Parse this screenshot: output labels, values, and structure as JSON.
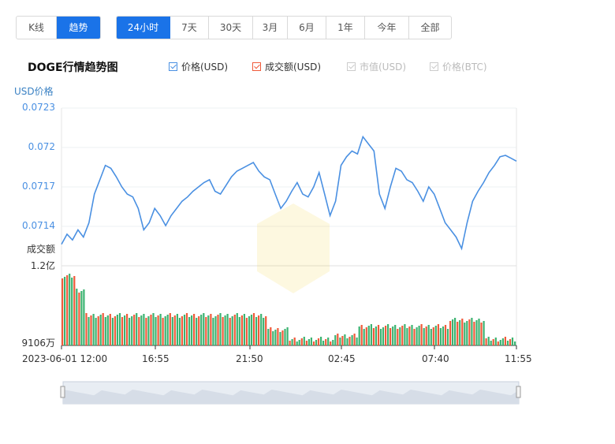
{
  "tabs_view": [
    {
      "label": "K线",
      "active": false
    },
    {
      "label": "趋势",
      "active": true
    }
  ],
  "tabs_range": [
    {
      "label": "24小时",
      "active": true
    },
    {
      "label": "7天",
      "active": false
    },
    {
      "label": "30天",
      "active": false
    },
    {
      "label": "3月",
      "active": false
    },
    {
      "label": "6月",
      "active": false
    },
    {
      "label": "1年",
      "active": false
    },
    {
      "label": "今年",
      "active": false
    },
    {
      "label": "全部",
      "active": false
    }
  ],
  "chart_title": "DOGE行情趋势图",
  "legend": [
    {
      "label": "价格(USD)",
      "checked": true,
      "color": "#4a90e2",
      "enabled": true
    },
    {
      "label": "成交额(USD)",
      "checked": true,
      "color": "#f05a3a",
      "enabled": true
    },
    {
      "label": "市值(USD)",
      "checked": false,
      "color": "#cccccc",
      "enabled": false
    },
    {
      "label": "价格(BTC)",
      "checked": false,
      "color": "#cccccc",
      "enabled": false
    }
  ],
  "chart_data": {
    "type": "line",
    "price_axis_label": "USD价格",
    "price_ticks": [
      "0.0723",
      "0.072",
      "0.0717",
      "0.0714"
    ],
    "ylim": [
      0.0712,
      0.0723
    ],
    "volume_axis_label": "成交额",
    "volume_ticks": [
      "1.2亿",
      "9106万"
    ],
    "x_ticks": [
      "2023-06-01 12:00",
      "16:55",
      "21:50",
      "02:45",
      "07:40",
      "11:55"
    ],
    "colors": {
      "price": "#4a90e2",
      "volume_up": "#f05a3a",
      "volume_down": "#3cb371"
    },
    "price": [
      0.07135,
      0.07142,
      0.07138,
      0.07145,
      0.0714,
      0.0715,
      0.0717,
      0.0718,
      0.0719,
      0.07188,
      0.07182,
      0.07175,
      0.0717,
      0.07168,
      0.0716,
      0.07145,
      0.0715,
      0.0716,
      0.07155,
      0.07148,
      0.07155,
      0.0716,
      0.07165,
      0.07168,
      0.07172,
      0.07175,
      0.07178,
      0.0718,
      0.07172,
      0.0717,
      0.07176,
      0.07182,
      0.07186,
      0.07188,
      0.0719,
      0.07192,
      0.07186,
      0.07182,
      0.0718,
      0.0717,
      0.0716,
      0.07165,
      0.07172,
      0.07178,
      0.0717,
      0.07168,
      0.07175,
      0.07185,
      0.0717,
      0.07155,
      0.07165,
      0.0719,
      0.07196,
      0.072,
      0.07198,
      0.0721,
      0.07205,
      0.072,
      0.0717,
      0.0716,
      0.07175,
      0.07188,
      0.07186,
      0.0718,
      0.07178,
      0.07172,
      0.07165,
      0.07175,
      0.0717,
      0.0716,
      0.0715,
      0.07145,
      0.0714,
      0.07132,
      0.0715,
      0.07165,
      0.07172,
      0.07178,
      0.07185,
      0.0719,
      0.07196,
      0.07197,
      0.07195,
      0.07193
    ]
  }
}
